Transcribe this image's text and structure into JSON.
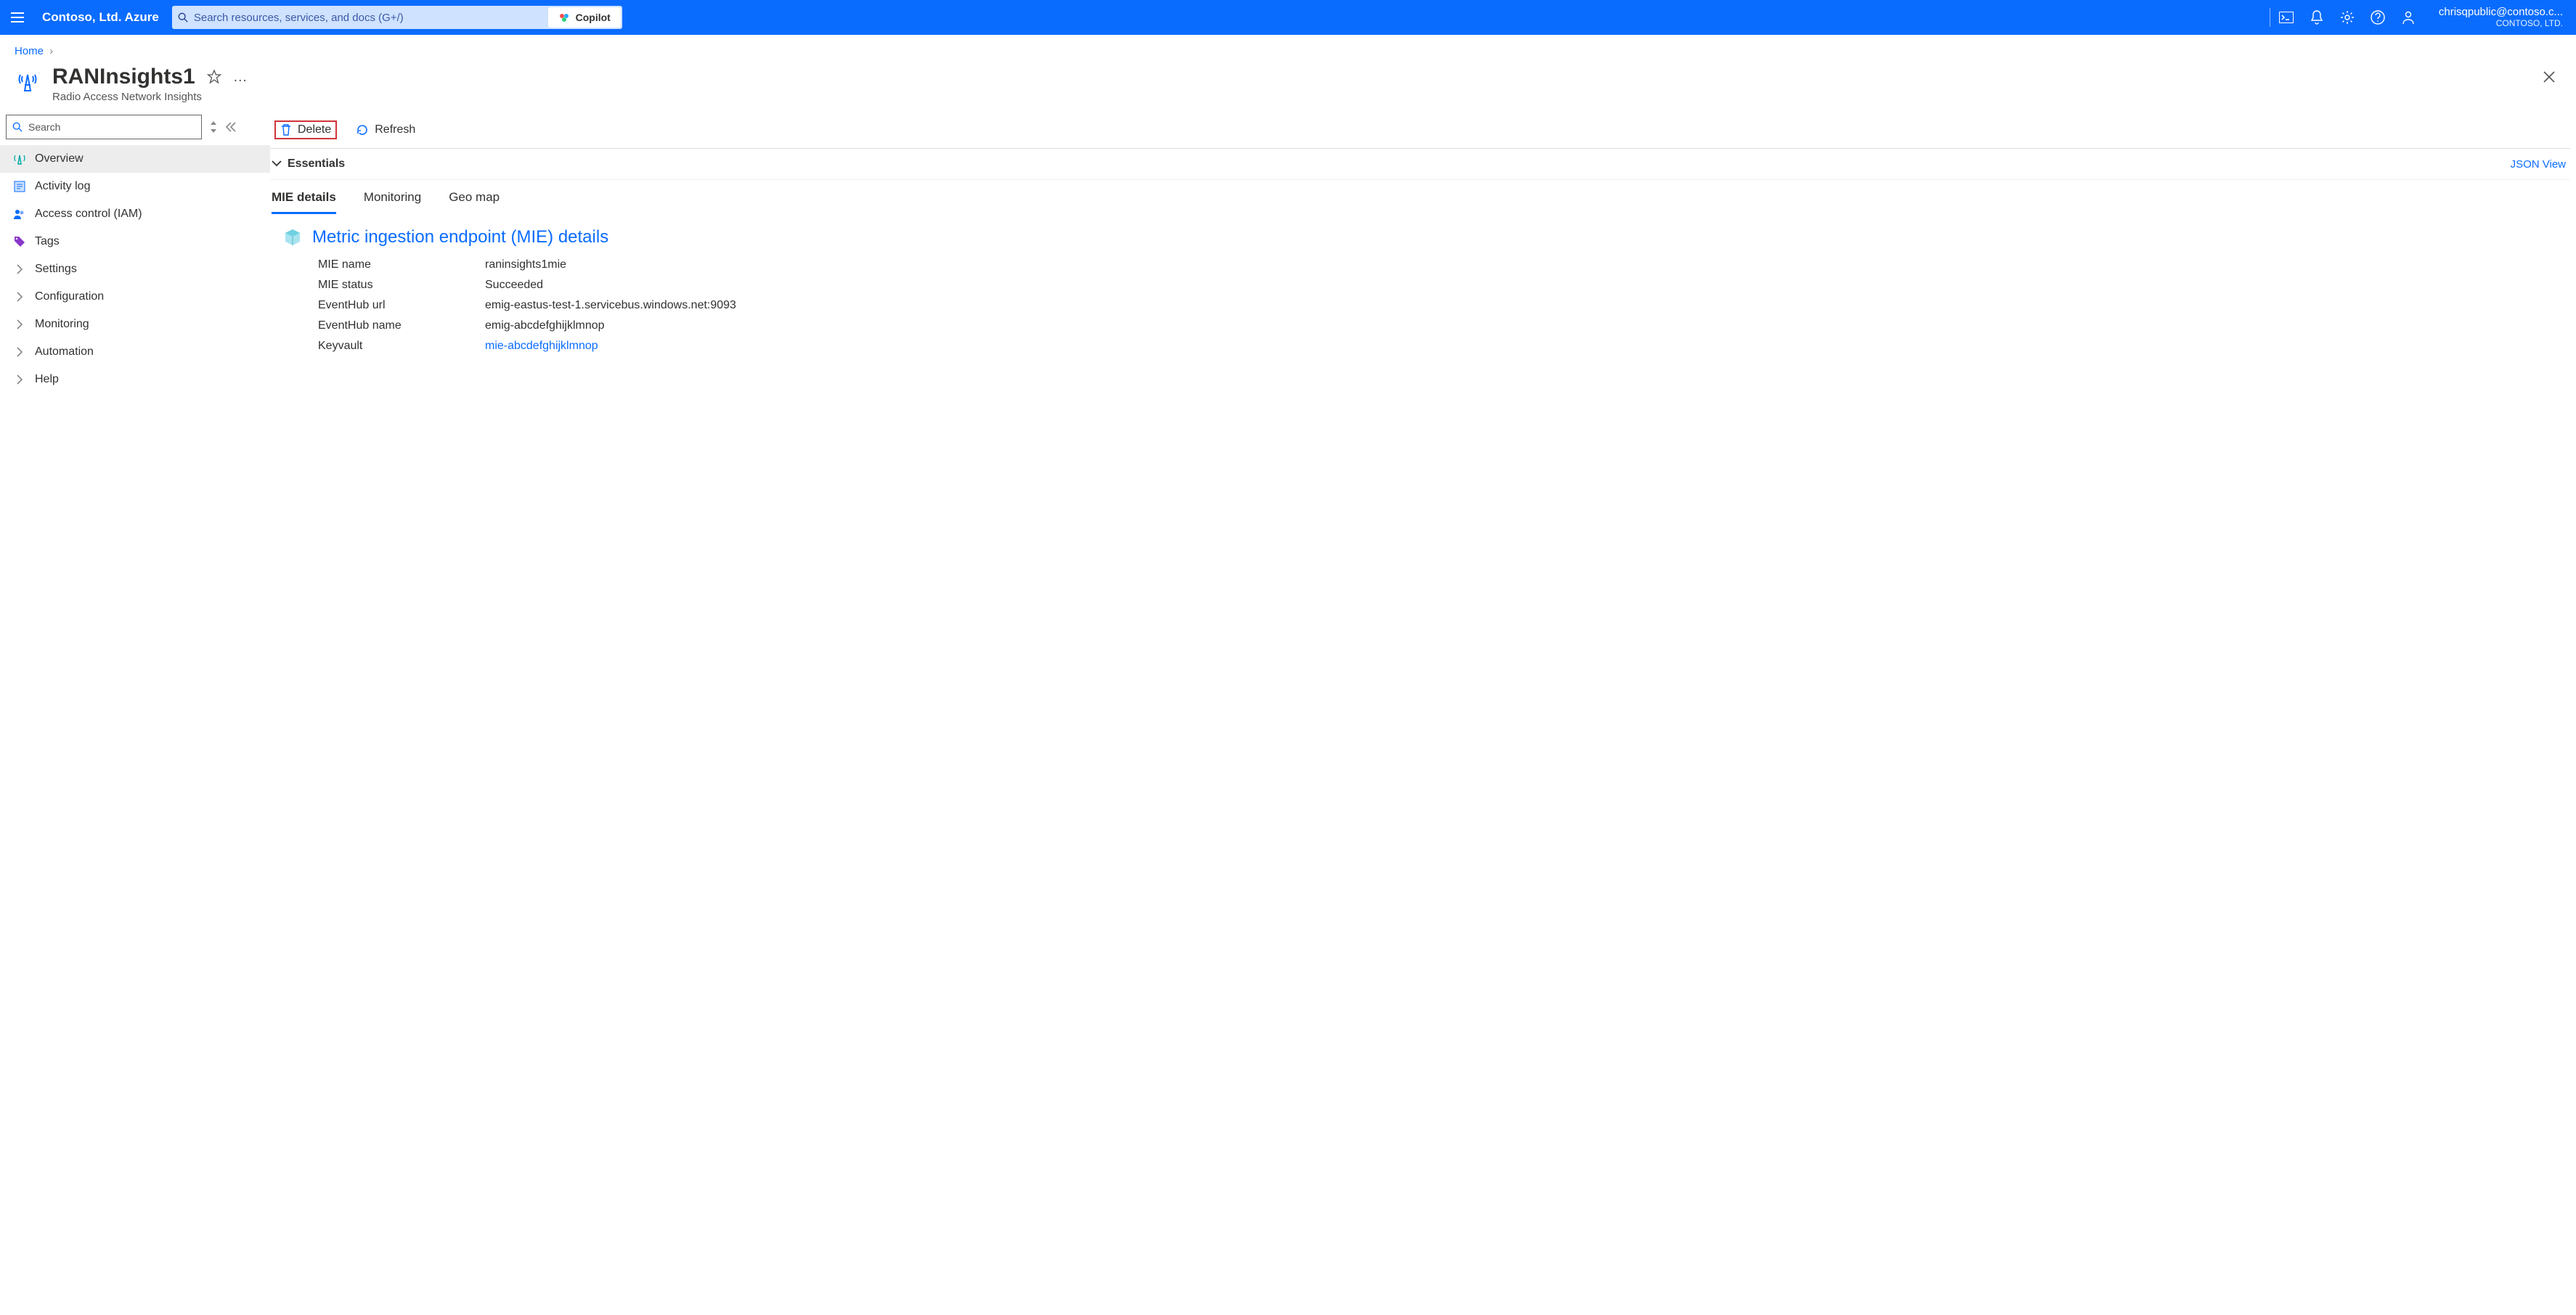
{
  "header": {
    "brand": "Contoso, Ltd. Azure",
    "search_placeholder": "Search resources, services, and docs (G+/)",
    "copilot_label": "Copilot",
    "user_email": "chrisqpublic@contoso.c...",
    "user_tenant": "CONTOSO, LTD."
  },
  "breadcrumb": {
    "items": [
      "Home"
    ]
  },
  "page": {
    "title": "RANInsights1",
    "subtitle": "Radio Access Network Insights"
  },
  "sidebar": {
    "search_placeholder": "Search",
    "items": [
      {
        "label": "Overview",
        "icon": "tower",
        "active": true
      },
      {
        "label": "Activity log",
        "icon": "log"
      },
      {
        "label": "Access control (IAM)",
        "icon": "people"
      },
      {
        "label": "Tags",
        "icon": "tag"
      },
      {
        "label": "Settings",
        "icon": "chevron"
      },
      {
        "label": "Configuration",
        "icon": "chevron"
      },
      {
        "label": "Monitoring",
        "icon": "chevron"
      },
      {
        "label": "Automation",
        "icon": "chevron"
      },
      {
        "label": "Help",
        "icon": "chevron"
      }
    ]
  },
  "toolbar": {
    "delete_label": "Delete",
    "refresh_label": "Refresh"
  },
  "essentials": {
    "toggle_label": "Essentials",
    "json_view_label": "JSON View"
  },
  "tabs": [
    {
      "label": "MIE details",
      "active": true
    },
    {
      "label": "Monitoring"
    },
    {
      "label": "Geo map"
    }
  ],
  "mie_section": {
    "title": "Metric ingestion endpoint (MIE) details",
    "rows": [
      {
        "key": "MIE name",
        "value": "raninsights1mie"
      },
      {
        "key": "MIE status",
        "value": "Succeeded"
      },
      {
        "key": "EventHub url",
        "value": "emig-eastus-test-1.servicebus.windows.net:9093"
      },
      {
        "key": "EventHub name",
        "value": "emig-abcdefghijklmnop"
      },
      {
        "key": "Keyvault",
        "value": "mie-abcdefghijklmnop",
        "link": true
      }
    ]
  }
}
